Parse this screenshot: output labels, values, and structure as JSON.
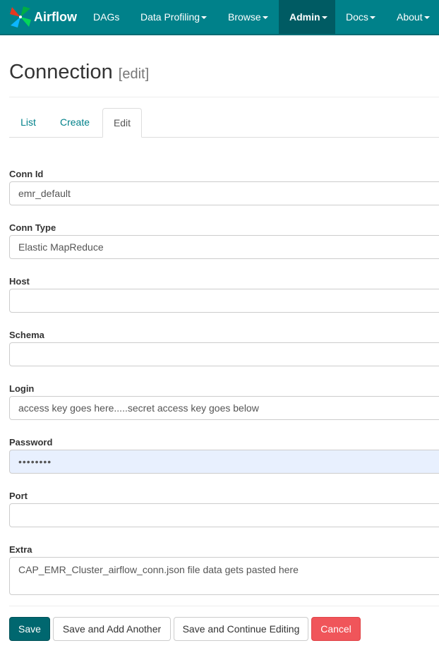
{
  "navbar": {
    "brand": "Airflow",
    "items": [
      {
        "label": "DAGs",
        "dropdown": false
      },
      {
        "label": "Data Profiling",
        "dropdown": true
      },
      {
        "label": "Browse",
        "dropdown": true
      },
      {
        "label": "Admin",
        "dropdown": true,
        "active": true
      },
      {
        "label": "Docs",
        "dropdown": true
      },
      {
        "label": "About",
        "dropdown": true
      }
    ]
  },
  "header": {
    "title": "Connection",
    "subtitle": "[edit]"
  },
  "tabs": [
    {
      "label": "List"
    },
    {
      "label": "Create"
    },
    {
      "label": "Edit",
      "active": true
    }
  ],
  "form": {
    "conn_id": {
      "label": "Conn Id",
      "value": "emr_default"
    },
    "conn_type": {
      "label": "Conn Type",
      "value": "Elastic MapReduce"
    },
    "host": {
      "label": "Host",
      "value": ""
    },
    "schema": {
      "label": "Schema",
      "value": ""
    },
    "login": {
      "label": "Login",
      "value": "access key goes here.....secret access key goes below"
    },
    "password": {
      "label": "Password",
      "value": "••••••••"
    },
    "port": {
      "label": "Port",
      "value": ""
    },
    "extra": {
      "label": "Extra",
      "value": "CAP_EMR_Cluster_airflow_conn.json file data gets pasted here"
    }
  },
  "buttons": {
    "save": "Save",
    "save_add": "Save and Add Another",
    "save_continue": "Save and Continue Editing",
    "cancel": "Cancel"
  },
  "colors": {
    "navbar": "#00818a",
    "primary": "#00676f",
    "danger": "#f0555a"
  }
}
